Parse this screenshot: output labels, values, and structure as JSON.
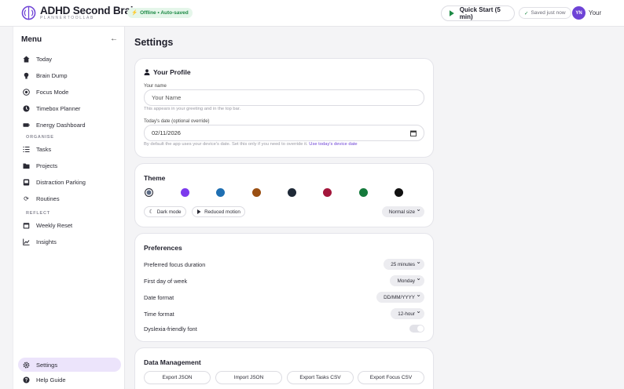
{
  "header": {
    "app_title": "ADHD Second Brain",
    "app_subtitle": "PLANNERTOOLLAB",
    "offline_badge": "Offline • Auto-saved",
    "quick_start": "Quick Start (5 min)",
    "saved_status": "Saved just now",
    "avatar_initials": "YN",
    "user_name": "Your",
    "colors": {
      "accent": "#6e43d6",
      "badge_bg": "#e5f6ea",
      "badge_text": "#1d8a45",
      "play": "#1d8a45"
    }
  },
  "sidebar": {
    "title": "Menu",
    "items": [
      {
        "label": "Today",
        "icon": "home-icon"
      },
      {
        "label": "Brain Dump",
        "icon": "lightbulb-icon"
      },
      {
        "label": "Focus Mode",
        "icon": "target-icon"
      },
      {
        "label": "Timebox Planner",
        "icon": "clock-icon"
      },
      {
        "label": "Energy Dashboard",
        "icon": "battery-icon"
      }
    ],
    "section_organise": "ORGANISE",
    "organise_items": [
      {
        "label": "Tasks",
        "icon": "list-icon"
      },
      {
        "label": "Projects",
        "icon": "folder-icon"
      },
      {
        "label": "Distraction Parking",
        "icon": "parking-icon"
      },
      {
        "label": "Routines",
        "icon": "refresh-icon"
      }
    ],
    "section_reflect": "REFLECT",
    "reflect_items": [
      {
        "label": "Weekly Reset",
        "icon": "calendar-icon"
      },
      {
        "label": "Insights",
        "icon": "chart-icon"
      }
    ],
    "bottom_items": [
      {
        "label": "Settings",
        "icon": "gear-icon",
        "active": true
      },
      {
        "label": "Help Guide",
        "icon": "help-icon"
      }
    ]
  },
  "main": {
    "page_title": "Settings",
    "profile": {
      "title": "Your Profile",
      "name_label": "Your name",
      "name_placeholder": "Your Name",
      "name_hint": "This appears in your greeting and in the top bar.",
      "date_label": "Today's date (optional override)",
      "date_value": "02/11/2026",
      "date_hint": "By default the app uses your device's date. Set this only if you need to override it.",
      "date_link": "Use today's device date"
    },
    "theme": {
      "title": "Theme",
      "swatches": [
        "#5c6b85",
        "#7c3aed",
        "#1f6fb2",
        "#9a4f12",
        "#1f2937",
        "#a3163b",
        "#157a3c",
        "#111111"
      ],
      "dark_mode": "Dark mode",
      "reduced_motion": "Reduced motion",
      "size_value": "Normal size"
    },
    "preferences": {
      "title": "Preferences",
      "rows": [
        {
          "label": "Preferred focus duration",
          "value": "25 minutes"
        },
        {
          "label": "First day of week",
          "value": "Monday"
        },
        {
          "label": "Date format",
          "value": "DD/MM/YYYY"
        },
        {
          "label": "Time format",
          "value": "12-hour"
        }
      ],
      "dyslexia_label": "Dyslexia-friendly font",
      "dyslexia_on": false
    },
    "data_management": {
      "title": "Data Management",
      "buttons": [
        "Export JSON",
        "Import JSON",
        "Export Tasks CSV",
        "Export Focus CSV"
      ]
    }
  }
}
